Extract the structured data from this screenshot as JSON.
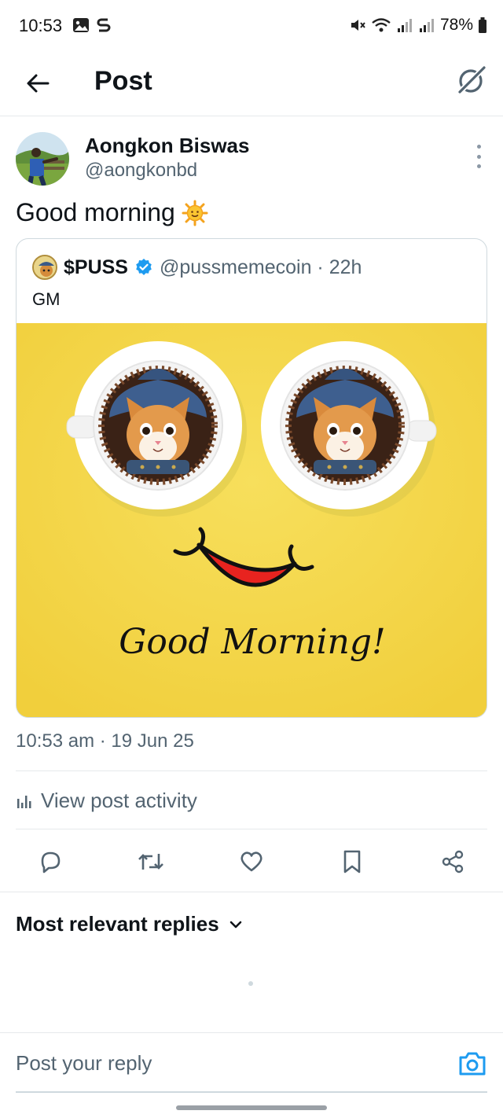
{
  "status_bar": {
    "time": "10:53",
    "battery": "78%",
    "icons_left": [
      "gallery-icon",
      "s-app-icon"
    ],
    "icons_right": [
      "mute-icon",
      "wifi-icon",
      "signal-icon",
      "signal-icon",
      "battery-icon"
    ]
  },
  "header": {
    "title": "Post",
    "back_icon": "arrow-left-icon",
    "grok_icon": "grok-icon"
  },
  "post": {
    "author_name": "Aongkon Biswas",
    "author_handle": "@aongkonbd",
    "text": "Good morning",
    "emoji": "sun-with-face-emoji",
    "timestamp": "10:53 am · 19 Jun 25"
  },
  "quote": {
    "name": "$PUSS",
    "verified": true,
    "handle_time": "@pussmemecoin · 22h",
    "body": "GM",
    "image_caption": "Good Morning!"
  },
  "activity": {
    "label": "View post activity",
    "icon": "analytics-icon"
  },
  "actions": [
    {
      "name": "reply-button",
      "icon": "comment-icon"
    },
    {
      "name": "repost-button",
      "icon": "repost-icon"
    },
    {
      "name": "like-button",
      "icon": "heart-icon"
    },
    {
      "name": "bookmark-button",
      "icon": "bookmark-icon"
    },
    {
      "name": "share-button",
      "icon": "share-icon"
    }
  ],
  "replies": {
    "sort_label": "Most relevant replies"
  },
  "reply_bar": {
    "placeholder": "Post your reply",
    "camera_icon": "camera-icon"
  },
  "colors": {
    "text_primary": "#0f1419",
    "text_secondary": "#536471",
    "accent_blue": "#1d9bf0",
    "media_yellow": "#f5d94a",
    "divider": "#e6e9eb"
  }
}
